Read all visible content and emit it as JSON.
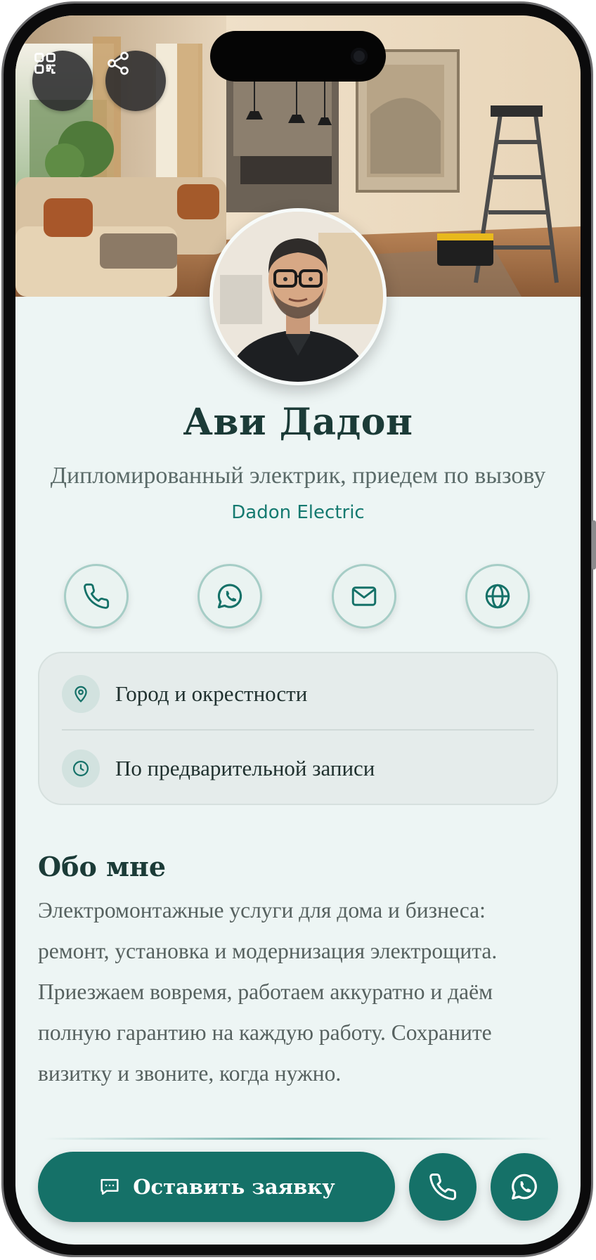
{
  "profile": {
    "name": "Ави Дадон",
    "title": "Дипломированный электрик, приедем по вызову",
    "company": "Dadon Electric"
  },
  "top_actions": {
    "qr": "qr-code-icon",
    "share": "share-icon"
  },
  "contacts": [
    {
      "icon": "phone-icon"
    },
    {
      "icon": "whatsapp-icon"
    },
    {
      "icon": "mail-icon"
    },
    {
      "icon": "globe-icon"
    }
  ],
  "info": {
    "location": "Город и окрестности",
    "hours": "По предварительной записи"
  },
  "about": {
    "heading": "Обо мне",
    "text": "Электромонтажные услуги для дома и бизнеса: ремонт, установка и модернизация электрощита. Приезжаем вовремя, работаем аккуратно и даём полную гарантию на каждую работу. Сохраните визитку и звоните, когда нужно."
  },
  "bottom_bar": {
    "request_label": "Оставить заявку",
    "call": "phone-icon",
    "whatsapp": "whatsapp-icon"
  },
  "colors": {
    "accent": "#157168",
    "background": "#edf5f4",
    "heading": "#1b3b37"
  }
}
